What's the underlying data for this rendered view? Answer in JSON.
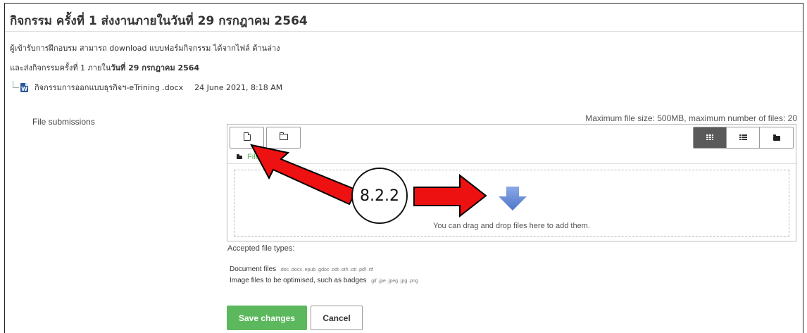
{
  "page": {
    "title": "กิจกรรม ครั้งที่ 1 ส่งงานภายในวันที่ 29 กรกฎาคม 2564",
    "intro_line1": "ผู้เข้ารับการฝึกอบรม สามารถ download แบบฟอร์มกิจกรรม ได้จากไฟล์ ด้านล่าง",
    "intro_line2_prefix": "และส่งกิจกรรมครั้งที่ 1 ภายใน",
    "intro_line2_bold": "วันที่ 29 กรกฎาคม 2564",
    "attachment": {
      "icon": "word-document-icon",
      "filename": "กิจกรรมการออกแบบธุรกิจฯ-eTrining .docx",
      "date": "24 June 2021, 8:18 AM"
    }
  },
  "form": {
    "submissions_label": "File submissions",
    "max_size_text": "Maximum file size: 500MB, maximum number of files: 20",
    "path_label": "Files",
    "drop_text": "You can drag and drop files here to add them.",
    "accepted_label": "Accepted file types:",
    "file_types": [
      {
        "name": "Document files",
        "ext": ".doc .docx .epub .gdoc .odt .oth .ott .pdf .rtf"
      },
      {
        "name": "Image files to be optimised, such as badges",
        "ext": ".gif .jpe .jpeg .jpg .png"
      }
    ],
    "save_label": "Save changes",
    "cancel_label": "Cancel"
  },
  "annotation": {
    "callout_label": "8.2.2",
    "arrow_color": "#ee1111"
  },
  "colors": {
    "save_green": "#5cb85c",
    "active_view": "#5a5a5a",
    "drop_arrow": "#6b8fd6"
  }
}
